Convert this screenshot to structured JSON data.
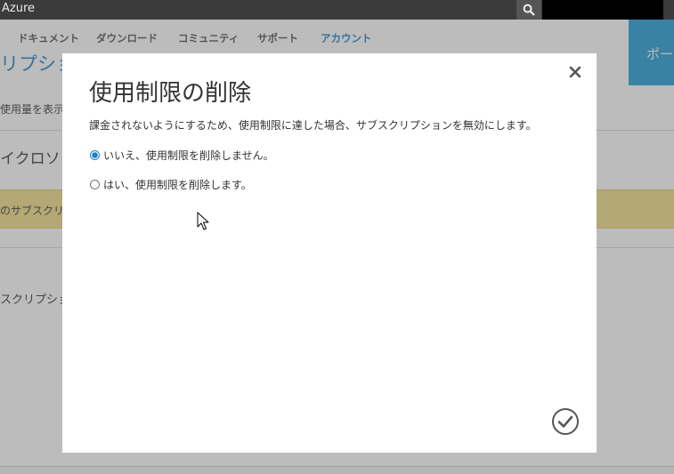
{
  "topbar": {
    "brand": "Azure"
  },
  "nav": {
    "items": [
      "ドキュメント",
      "ダウンロード",
      "コミュニティ",
      "サポート",
      "アカウント"
    ],
    "active": "アカウント",
    "portal_label": "ポー"
  },
  "background": {
    "heading": "リプショ",
    "usage_link": "使用量を表示",
    "section_title": "イクロソフ",
    "warning": "のサブスクリプ",
    "subscription_label": "スクリプショ"
  },
  "dialog": {
    "title": "使用制限の削除",
    "description": "課金されないようにするため、使用制限に達した場合、サブスクリプションを無効にします。",
    "options": [
      {
        "label": "いいえ、使用制限を削除しません。",
        "selected": true
      },
      {
        "label": "はい、使用制限を削除します。",
        "selected": false
      }
    ]
  },
  "colors": {
    "accent": "#1c7fc4",
    "portal": "#1e9bd6",
    "warning": "#f2dc83",
    "topbar": "#3b3b3b"
  },
  "icons": {
    "search": "search-icon",
    "close": "close-icon",
    "confirm": "checkmark-circle-icon",
    "cursor": "mouse-cursor-icon"
  }
}
